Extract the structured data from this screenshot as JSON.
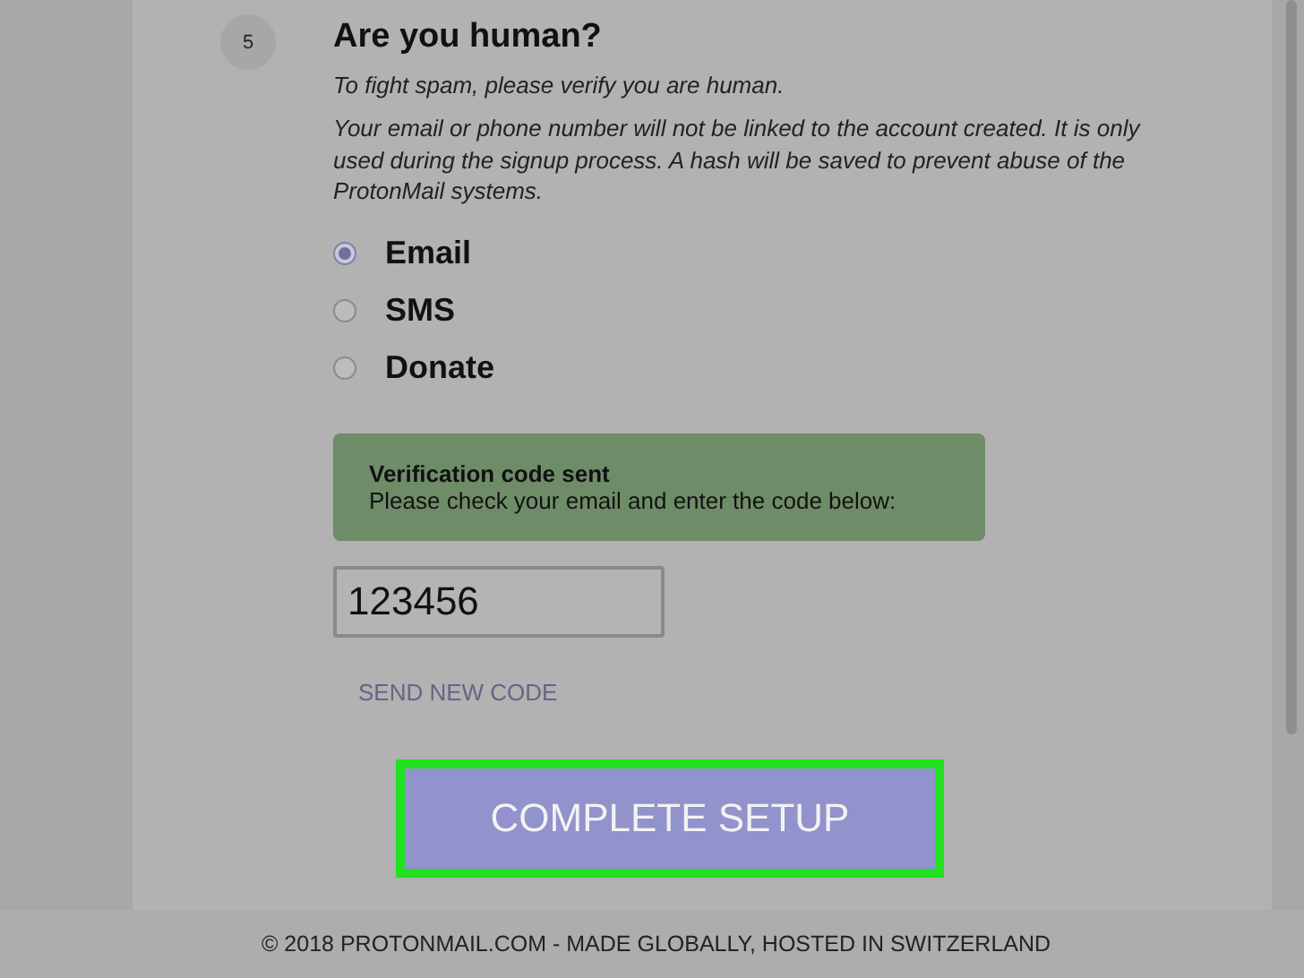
{
  "step": {
    "number": "5",
    "title": "Are you human?",
    "intro": "To fight spam, please verify you are human.",
    "notice": "Your email or phone number will not be linked to the account created. It is only used during the signup process. A hash will be saved to prevent abuse of the ProtonMail systems."
  },
  "methods": [
    {
      "label": "Email",
      "selected": true
    },
    {
      "label": "SMS",
      "selected": false
    },
    {
      "label": "Donate",
      "selected": false
    }
  ],
  "alert": {
    "title": "Verification code sent",
    "message": "Please check your email and enter the code below:"
  },
  "code_field": {
    "value": "123456"
  },
  "resend_link": "SEND NEW CODE",
  "submit_button": {
    "label": "COMPLETE SETUP",
    "highlighted": true
  },
  "footer": "© 2018 PROTONMAIL.COM - MADE GLOBALLY, HOSTED IN SWITZERLAND"
}
